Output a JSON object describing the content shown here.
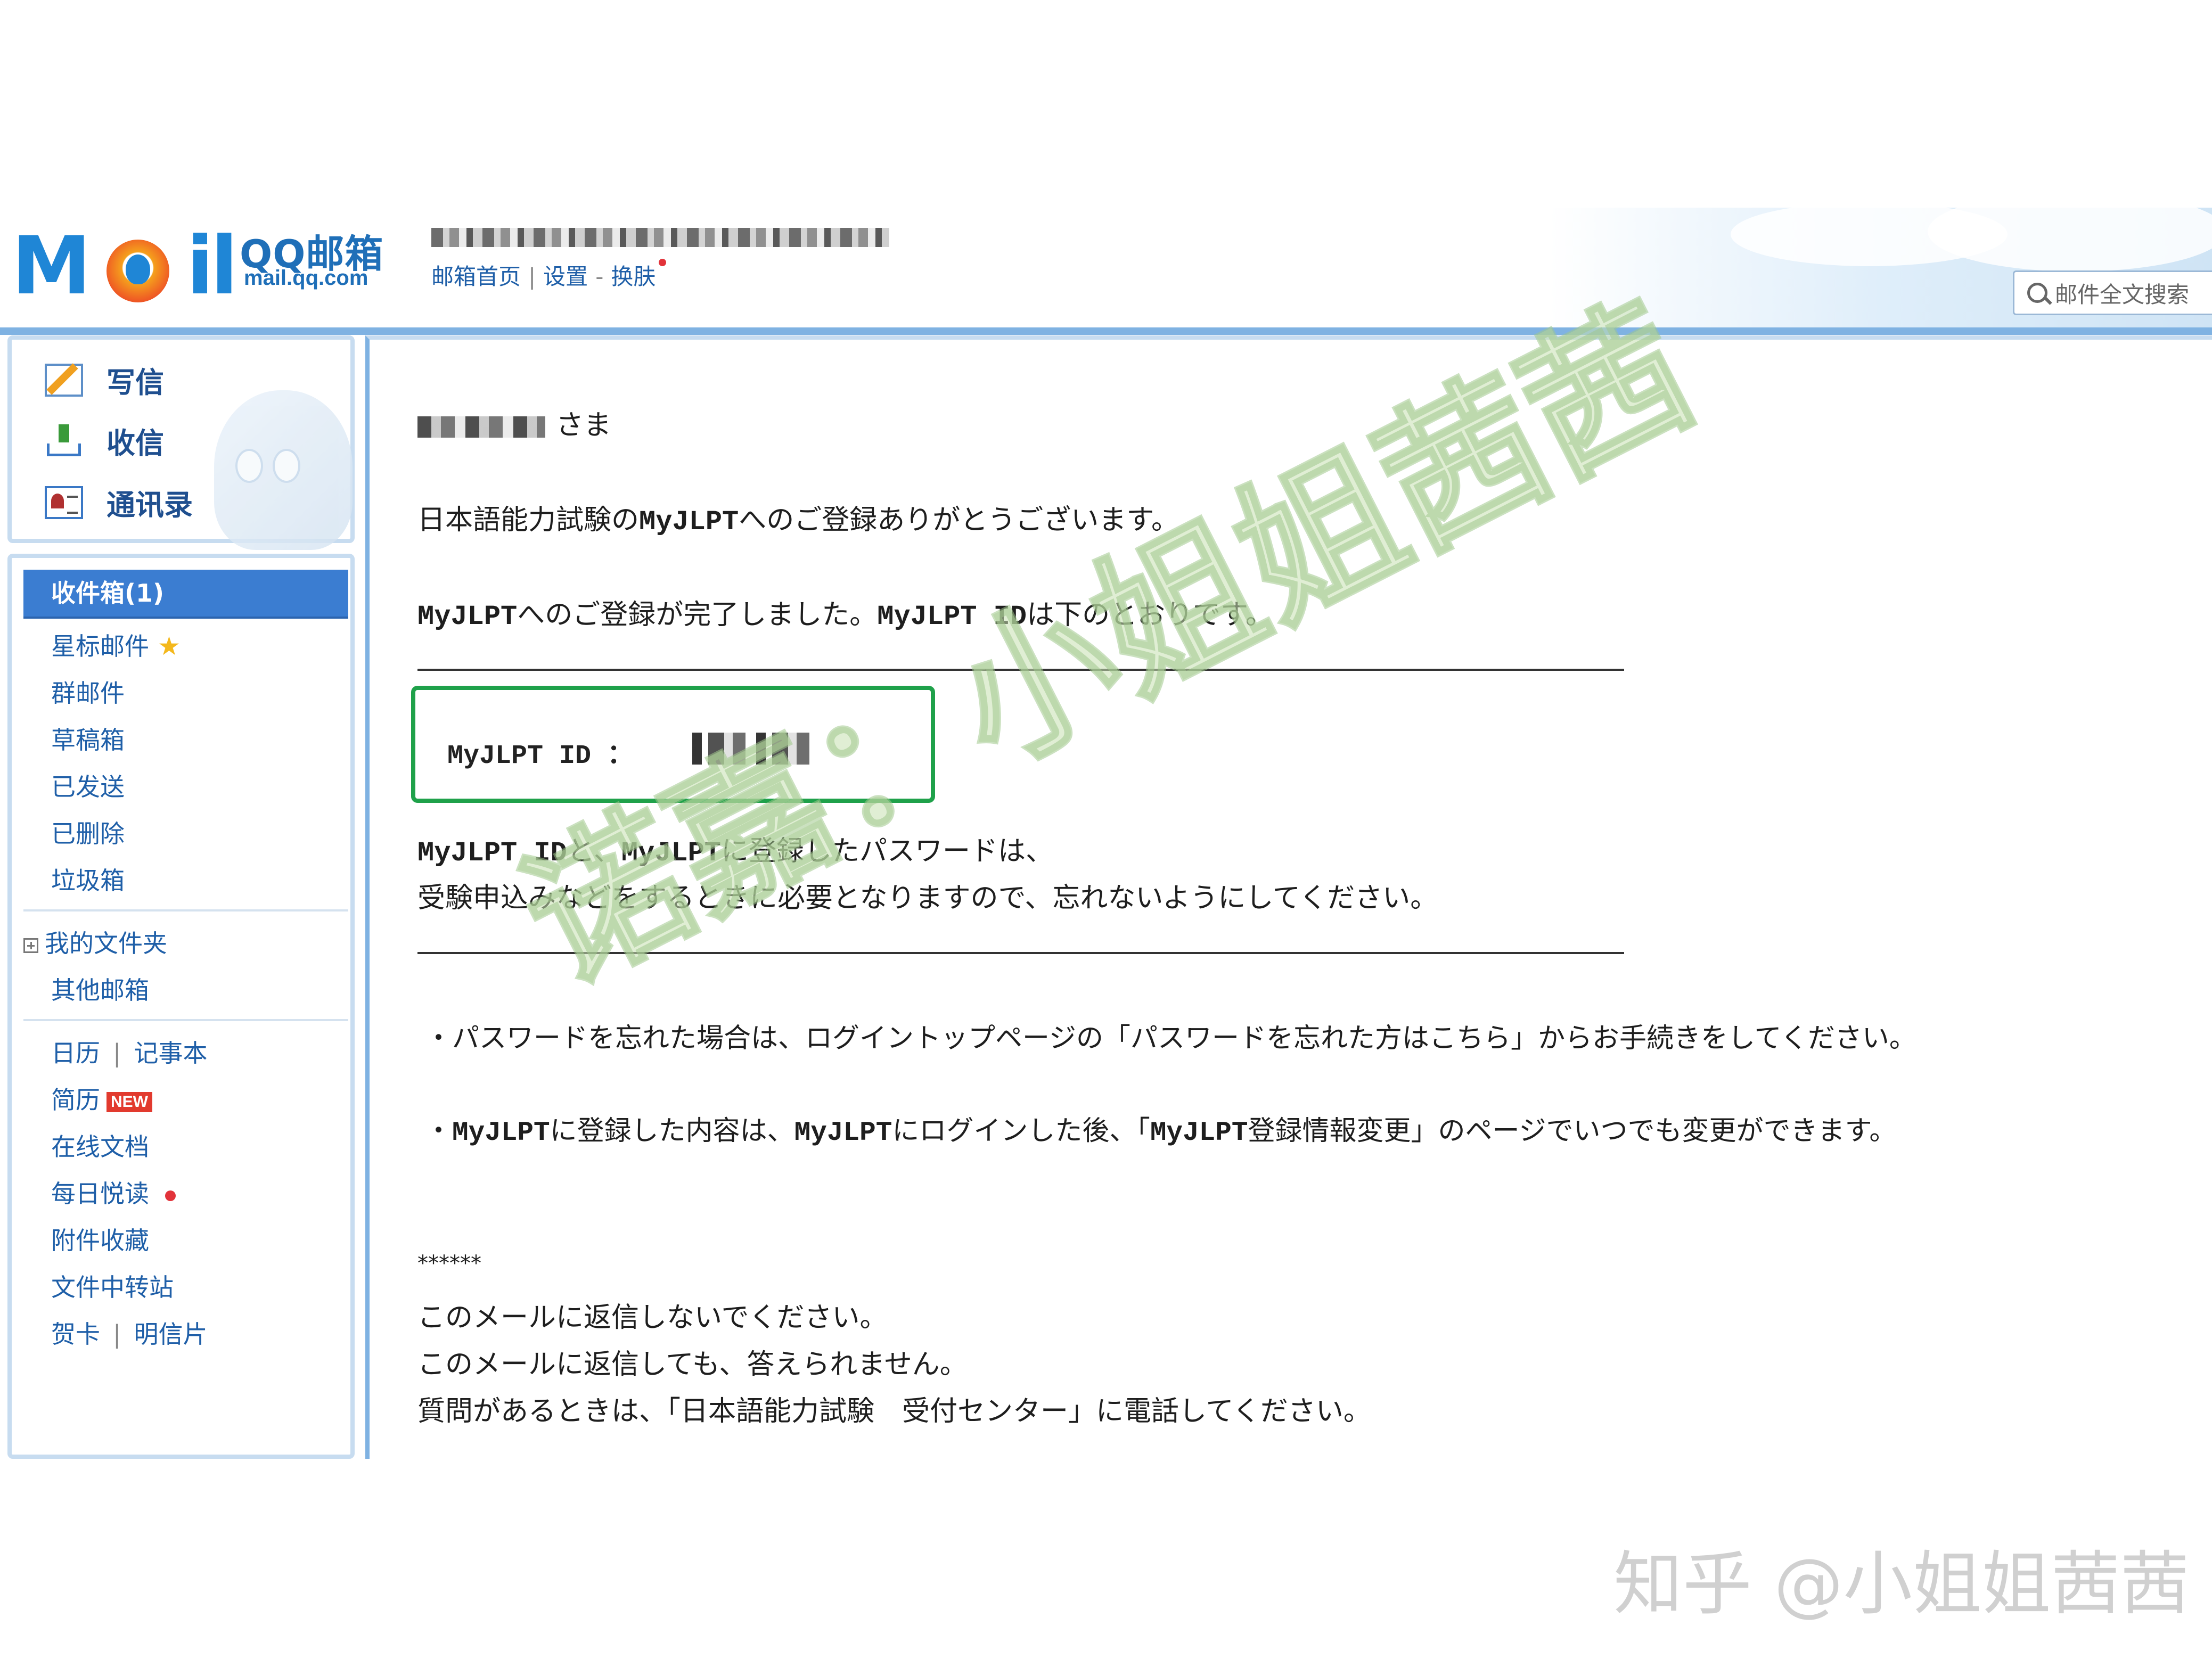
{
  "header": {
    "brand_name": "QQ邮箱",
    "brand_domain": "mail.qq.com",
    "links": [
      "邮箱首页",
      "设置",
      "换肤"
    ],
    "search_placeholder": "邮件全文搜索"
  },
  "sidebar": {
    "actions": [
      {
        "label": "写信",
        "icon": "compose-icon"
      },
      {
        "label": "收信",
        "icon": "receive-icon"
      },
      {
        "label": "通讯录",
        "icon": "contacts-icon"
      }
    ],
    "inbox": "收件箱(1)",
    "folders": [
      "星标邮件",
      "群邮件",
      "草稿箱",
      "已发送",
      "已删除",
      "垃圾箱"
    ],
    "my_folders": "我的文件夹",
    "other_mailbox": "其他邮箱",
    "tools": {
      "calendar": "日历",
      "notes": "记事本",
      "resume": "简历",
      "new_badge": "NEW",
      "docs": "在线文档",
      "daily_read": "每日悦读",
      "attachments": "附件收藏",
      "transfer": "文件中转站",
      "cards": "贺卡",
      "postcards": "明信片"
    }
  },
  "email": {
    "salutation": "さま",
    "p1_a": "日本語能力試験の",
    "p1_b": "MyJLPT",
    "p1_c": "へのご登録ありがとうございます。",
    "p2_a": "MyJLPT",
    "p2_b": "へのご登録が完了しました。",
    "p2_c": "MyJLPT ID",
    "p2_d": "は下のとおりです。",
    "id_label": "MyJLPT ID  ：",
    "p3_a": "MyJLPT ID",
    "p3_b": "と、",
    "p3_c": "MyJLPT",
    "p3_d": "に登録したパスワードは、",
    "p4": "受験申込みなどをするときに必要となりますので、忘れないようにしてください。",
    "b1": "・パスワードを忘れた場合は、ログイントップページの「パスワードを忘れた方はこちら」からお手続きをしてください。",
    "b2_a": "・",
    "b2_b": "MyJLPT",
    "b2_c": "に登録した内容は、",
    "b2_d": "MyJLPT",
    "b2_e": "にログインした後、「",
    "b2_f": "MyJLPT",
    "b2_g": "登録情報変更」のページでいつでも変更ができます。",
    "stars": "******",
    "f1": "このメールに返信しないでください。",
    "f2": "このメールに返信しても、答えられません。",
    "f3": "質問があるときは、「日本語能力試験　受付センター」に電話してください。"
  },
  "watermark": "诺嘉：小姐姐茜茜",
  "credit": "知乎 @小姐姐茜茜",
  "colors": {
    "accent": "#3b7dd1",
    "link": "#1f5fa8",
    "id_box": "#1fa14a"
  }
}
